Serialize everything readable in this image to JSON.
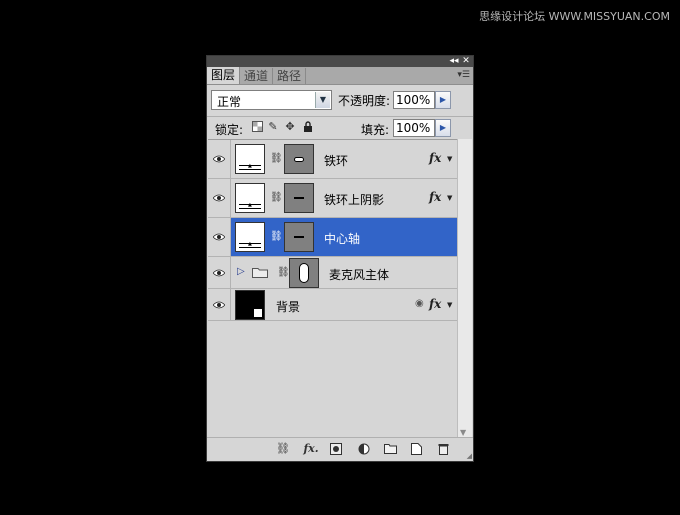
{
  "watermark": "思缘设计论坛 WWW.MISSYUAN.COM",
  "titlebar": {
    "collapse_icon": "double-arrow-left-icon",
    "close_icon": "close-icon"
  },
  "tabs": [
    {
      "label": "图层",
      "active": true
    },
    {
      "label": "通道",
      "active": false
    },
    {
      "label": "路径",
      "active": false
    }
  ],
  "blend_mode": "正常",
  "opacity_label": "不透明度:",
  "opacity_value": "100%",
  "lock_label": "锁定:",
  "fill_label": "填充:",
  "fill_value": "100%",
  "layers": [
    {
      "name": "铁环",
      "fx": "fx",
      "selected": false
    },
    {
      "name": "铁环上阴影",
      "fx": "fx",
      "selected": false
    },
    {
      "name": "中心轴",
      "fx": "",
      "selected": true
    },
    {
      "name": "麦克风主体",
      "fx": "",
      "selected": false,
      "group": true
    },
    {
      "name": "背景",
      "fx": "fx",
      "selected": false,
      "background": true
    }
  ],
  "colors": {
    "selection": "#3264c8",
    "panel": "#d6d6d6"
  }
}
